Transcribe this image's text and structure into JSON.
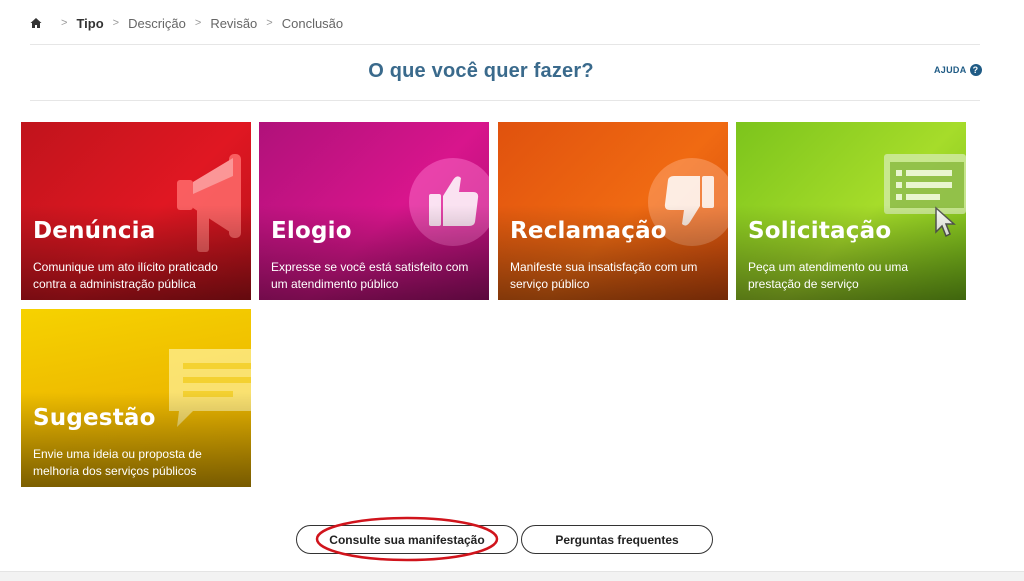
{
  "breadcrumb": {
    "home_icon": "home-icon",
    "items": [
      {
        "label": "Tipo",
        "active": true
      },
      {
        "label": "Descrição",
        "active": false
      },
      {
        "label": "Revisão",
        "active": false
      },
      {
        "label": "Conclusão",
        "active": false
      }
    ]
  },
  "header": {
    "title": "O que você quer fazer?",
    "help_label": "AJUDA",
    "help_icon": "question-circle-icon"
  },
  "cards": [
    {
      "title": "Denúncia",
      "description": "Comunique um ato ilícito praticado contra a administração pública",
      "icon": "megaphone-icon",
      "color": "#e01722"
    },
    {
      "title": "Elogio",
      "description": "Expresse se você está satisfeito com um atendimento público",
      "icon": "thumbs-up-icon",
      "color": "#d8158c"
    },
    {
      "title": "Reclamação",
      "description": "Manifeste sua insatisfação com um serviço público",
      "icon": "thumbs-down-icon",
      "color": "#f06a12"
    },
    {
      "title": "Solicitação",
      "description": "Peça um atendimento ou uma prestação de serviço",
      "icon": "monitor-pointer-icon",
      "color": "#a6dc2a"
    },
    {
      "title": "Sugestão",
      "description": "Envie uma ideia ou proposta de melhoria dos serviços públicos",
      "icon": "speech-bubble-icon",
      "color": "#edb800"
    }
  ],
  "actions": {
    "consult_label": "Consulte sua manifestação",
    "faq_label": "Perguntas frequentes"
  },
  "colors": {
    "title": "#3a6a8c",
    "help": "#1f5b85",
    "annotation": "#d0141c"
  }
}
